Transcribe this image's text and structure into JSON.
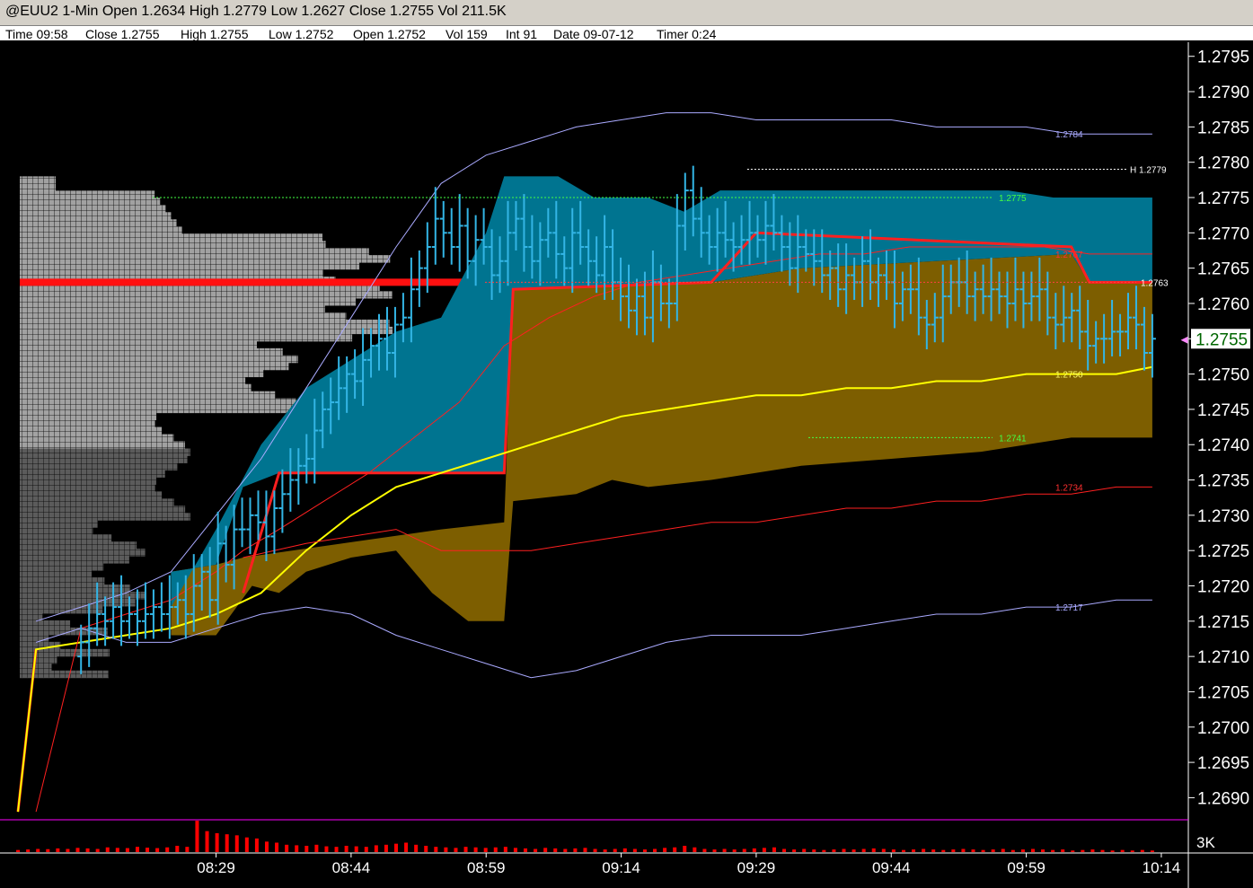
{
  "title_bar": {
    "text": "@EUU2 1-Min Open 1.2634 High 1.2779 Low 1.2627 Close 1.2755 Vol 211.5K"
  },
  "info_bar": {
    "items": [
      "Time 09:58",
      "Close 1.2755",
      "High 1.2755",
      "Low 1.2752",
      "Open 1.2752",
      "Vol 159",
      "Int 91",
      "Date 09-07-12",
      "Timer 0:24"
    ]
  },
  "colors": {
    "background": "#000000",
    "price_bars": "#33b5e5",
    "teal_band": "#007490",
    "olive_band": "#7d5e00",
    "vwap": "#ffff00",
    "red_line": "#ff2020",
    "outer_band": "#aaaaff",
    "profile_light": "#aaaaaa",
    "profile_dark": "#606060",
    "volume": "#ff0000",
    "axis": "#ffffff"
  },
  "chart_data": {
    "type": "line",
    "ylim": [
      1.2687,
      1.2797
    ],
    "xlim_minutes": [
      -24,
      108
    ],
    "y_ticks": [
      "1.2795",
      "1.2790",
      "1.2785",
      "1.2780",
      "1.2775",
      "1.2770",
      "1.2765",
      "1.2760",
      "1.2755",
      "1.2750",
      "1.2745",
      "1.2740",
      "1.2735",
      "1.2730",
      "1.2725",
      "1.2720",
      "1.2715",
      "1.2710",
      "1.2705",
      "1.2700",
      "1.2695",
      "1.2690"
    ],
    "x_ticks": [
      "08:29",
      "08:44",
      "08:59",
      "09:14",
      "09:29",
      "09:44",
      "09:59",
      "10:14"
    ],
    "current_price": "1.2755",
    "volume_axis_label": "3K",
    "level_labels": [
      {
        "text": "1.2784",
        "value": 1.2784,
        "color": "#aaaaff"
      },
      {
        "text": "H 1.2779",
        "value": 1.2779,
        "color": "#ffffff"
      },
      {
        "text": "1.2775",
        "value": 1.2775,
        "color": "#44ff44"
      },
      {
        "text": "1.2767",
        "value": 1.2767,
        "color": "#ff3030"
      },
      {
        "text": "1.2763",
        "value": 1.2763,
        "color": "#ffffff"
      },
      {
        "text": "1.2750",
        "value": 1.275,
        "color": "#ffff66"
      },
      {
        "text": "1.2741",
        "value": 1.2741,
        "color": "#44ff44"
      },
      {
        "text": "1.2734",
        "value": 1.2734,
        "color": "#ff3030"
      },
      {
        "text": "1.2717",
        "value": 1.2717,
        "color": "#aaaaff"
      }
    ],
    "series": [
      {
        "t": [
          -22,
          -20,
          -15,
          -10,
          -5,
          0,
          5,
          10,
          15,
          20,
          25,
          30,
          35,
          40,
          45,
          50,
          55,
          60,
          65,
          70,
          75,
          80,
          85,
          90,
          95,
          100,
          104
        ],
        "values": [
          1.2688,
          1.2711,
          1.2712,
          1.2713,
          1.2714,
          1.2716,
          1.2719,
          1.2725,
          1.273,
          1.2734,
          1.2736,
          1.2738,
          1.274,
          1.2742,
          1.2744,
          1.2745,
          1.2746,
          1.2747,
          1.2747,
          1.2748,
          1.2748,
          1.2749,
          1.2749,
          1.275,
          1.275,
          1.275,
          1.2751
        ]
      },
      {
        "t": [
          -20,
          -15,
          -10,
          -5,
          0,
          3,
          7,
          12,
          17,
          22,
          27,
          32,
          37,
          42,
          47,
          52,
          57,
          62,
          67,
          72,
          77,
          82,
          87,
          92,
          97,
          104
        ],
        "values": [
          1.2688,
          1.2714,
          1.2716,
          1.2718,
          1.2722,
          1.2725,
          1.2728,
          1.2732,
          1.2736,
          1.2741,
          1.2746,
          1.2754,
          1.2758,
          1.2761,
          1.2763,
          1.2764,
          1.2765,
          1.2766,
          1.2767,
          1.2767,
          1.2768,
          1.2768,
          1.2768,
          1.2768,
          1.2767,
          1.2767
        ]
      },
      {
        "t": [
          3,
          10,
          15,
          20,
          25,
          30,
          35,
          40,
          45,
          50,
          55,
          60,
          65,
          70,
          75,
          80,
          85,
          90,
          95,
          100,
          104
        ],
        "values": [
          1.2724,
          1.2726,
          1.2727,
          1.2728,
          1.2725,
          1.2725,
          1.2725,
          1.2726,
          1.2727,
          1.2728,
          1.2729,
          1.2729,
          1.273,
          1.2731,
          1.2731,
          1.2732,
          1.2732,
          1.2733,
          1.2733,
          1.2734,
          1.2734
        ]
      },
      {
        "t": [
          -20,
          -15,
          -10,
          -5,
          0,
          5,
          10,
          15,
          20,
          25,
          30,
          35,
          40,
          45,
          50,
          55,
          60,
          65,
          70,
          75,
          80,
          85,
          90,
          95,
          100,
          104
        ],
        "values": [
          1.2712,
          1.2714,
          1.2712,
          1.2712,
          1.2714,
          1.2716,
          1.2717,
          1.2716,
          1.2713,
          1.2711,
          1.2709,
          1.2707,
          1.2708,
          1.271,
          1.2712,
          1.2713,
          1.2713,
          1.2713,
          1.2714,
          1.2715,
          1.2716,
          1.2716,
          1.2717,
          1.2717,
          1.2718,
          1.2718
        ]
      },
      {
        "t": [
          -20,
          -15,
          -10,
          -5,
          0,
          5,
          10,
          15,
          20,
          25,
          30,
          35,
          40,
          45,
          50,
          55,
          60,
          65,
          70,
          75,
          80,
          85,
          90,
          95,
          100,
          104
        ],
        "values": [
          1.2715,
          1.2717,
          1.2719,
          1.2722,
          1.273,
          1.2738,
          1.2748,
          1.2758,
          1.2768,
          1.2777,
          1.2781,
          1.2783,
          1.2785,
          1.2786,
          1.2787,
          1.2787,
          1.2786,
          1.2786,
          1.2786,
          1.2786,
          1.2785,
          1.2785,
          1.2785,
          1.2784,
          1.2784,
          1.2784
        ]
      }
    ],
    "price_bars_close": [
      1.2712,
      1.2714,
      1.2716,
      1.2715,
      1.2717,
      1.2715,
      1.2716,
      1.2715,
      1.2716,
      1.2717,
      1.2716,
      1.2717,
      1.2718,
      1.2716,
      1.272,
      1.2722,
      1.2718,
      1.2726,
      1.2723,
      1.2728,
      1.2728,
      1.273,
      1.2729,
      1.2727,
      1.2731,
      1.2733,
      1.2735,
      1.2737,
      1.2738,
      1.2742,
      1.2745,
      1.2746,
      1.2748,
      1.275,
      1.2749,
      1.2752,
      1.2754,
      1.2755,
      1.2753,
      1.2757,
      1.2758,
      1.2762,
      1.2765,
      1.2768,
      1.2772,
      1.277,
      1.2768,
      1.2771,
      1.2766,
      1.2769,
      1.2768,
      1.2764,
      1.2766,
      1.277,
      1.2772,
      1.2768,
      1.2766,
      1.2769,
      1.277,
      1.2767,
      1.2765,
      1.277,
      1.2768,
      1.2766,
      1.2764,
      1.2768,
      1.2763,
      1.2761,
      1.2759,
      1.2761,
      1.2758,
      1.2763,
      1.276,
      1.276,
      1.2771,
      1.2776,
      1.2772,
      1.277,
      1.2768,
      1.277,
      1.2769,
      1.2768,
      1.2769,
      1.277,
      1.2769,
      1.2771,
      1.277,
      1.2768,
      1.2765,
      1.2768,
      1.2767,
      1.2766,
      1.2764,
      1.2765,
      1.2762,
      1.2764,
      1.2763,
      1.2766,
      1.2763,
      1.2764,
      1.2763,
      1.276,
      1.2762,
      1.2762,
      1.2758,
      1.2757,
      1.2758,
      1.2761,
      1.2763,
      1.2763,
      1.2761,
      1.2762,
      1.2761,
      1.2762,
      1.2761,
      1.276,
      1.2762,
      1.276,
      1.2761,
      1.2762,
      1.2758,
      1.2757,
      1.2758,
      1.2759,
      1.2756,
      1.2754,
      1.2755,
      1.2755,
      1.2756,
      1.2756,
      1.2758,
      1.2757,
      1.2753,
      1.2755
    ],
    "volume": [
      200,
      250,
      300,
      280,
      350,
      300,
      400,
      350,
      300,
      450,
      400,
      380,
      500,
      420,
      380,
      450,
      600,
      500,
      3000,
      2000,
      1800,
      1700,
      1600,
      1400,
      1300,
      1000,
      900,
      700,
      650,
      600,
      700,
      550,
      500,
      600,
      550,
      500,
      650,
      700,
      800,
      900,
      700,
      600,
      500,
      450,
      400,
      500,
      450,
      400,
      450,
      500,
      400,
      350,
      300,
      400,
      350,
      300,
      350,
      400,
      300,
      250,
      300,
      350,
      300,
      250,
      300,
      400,
      450,
      600,
      450,
      300,
      250,
      300,
      250,
      300,
      350,
      400,
      450,
      300,
      250,
      300,
      250,
      200,
      250,
      300,
      250,
      300,
      350,
      300,
      250,
      200,
      250,
      300,
      250,
      200,
      250,
      300,
      250,
      200,
      250,
      300,
      200,
      250,
      300,
      250,
      200,
      250,
      150,
      200,
      250,
      200,
      150,
      200,
      150,
      200,
      150
    ]
  }
}
